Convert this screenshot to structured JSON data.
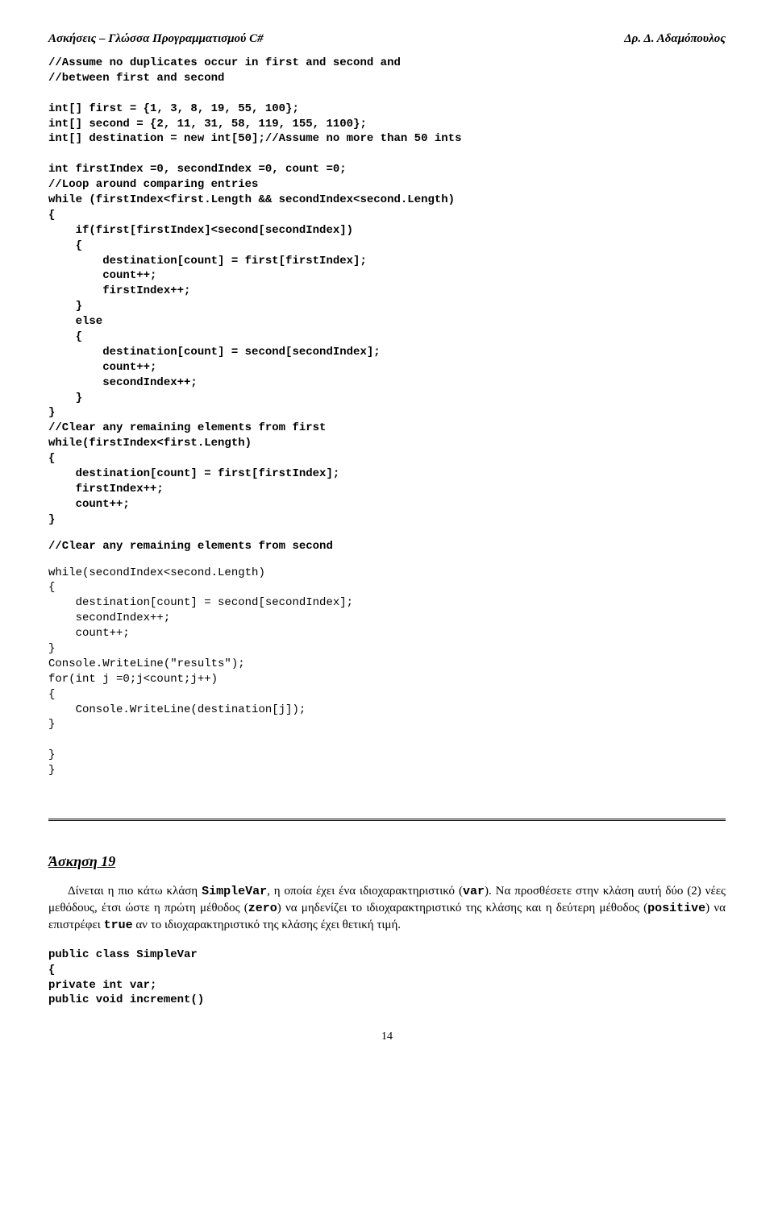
{
  "header": {
    "left": "Ασκήσεις – Γλώσσα Προγραμματισμού C#",
    "right": "Δρ. Δ. Αδαμόπουλος"
  },
  "code1": "//Assume no duplicates occur in first and second and\n//between first and second\n\nint[] first = {1, 3, 8, 19, 55, 100};\nint[] second = {2, 11, 31, 58, 119, 155, 1100};\nint[] destination = new int[50];//Assume no more than 50 ints\n\nint firstIndex =0, secondIndex =0, count =0;\n//Loop around comparing entries\nwhile (firstIndex<first.Length && secondIndex<second.Length)\n{\n    if(first[firstIndex]<second[secondIndex])\n    {\n        destination[count] = first[firstIndex];\n        count++;\n        firstIndex++;\n    }\n    else\n    {\n        destination[count] = second[secondIndex];\n        count++;\n        secondIndex++;\n    }\n}\n//Clear any remaining elements from first\nwhile(firstIndex<first.Length)\n{\n    destination[count] = first[firstIndex];\n    firstIndex++;\n    count++;\n}",
  "code2": "//Clear any remaining elements from second",
  "code3": "while(secondIndex<second.Length)\n{\n    destination[count] = second[secondIndex];\n    secondIndex++;\n    count++;\n}\nConsole.WriteLine(\"results\");\nfor(int j =0;j<count;j++)\n{\n    Console.WriteLine(destination[j]);\n}\n\n}\n}",
  "exercise": {
    "title": "Άσκηση 19",
    "lead": "Δίνεται η πιο κάτω κλάση ",
    "m_simplevar": "SimpleVar",
    "p1": ", η οποία έχει ένα ιδιοχαρακτηριστικό (",
    "m_var": "var",
    "p2": "). Να προσθέσετε στην κλάση αυτή δύο (2) νέες μεθόδους, έτσι ώστε η πρώτη μέθοδος (",
    "m_zero": "zero",
    "p3": ") να μηδενίζει το ιδιοχαρακτηριστικό της κλάσης και η δεύτερη μέθοδος (",
    "m_positive": "positive",
    "p4": ") να επιστρέφει ",
    "m_true": "true",
    "p5": " αν το ιδιοχαρακτηριστικό της κλάσης έχει θετική τιμή."
  },
  "code4": "public class SimpleVar\n{\nprivate int var;\npublic void increment()",
  "pageNumber": "14"
}
